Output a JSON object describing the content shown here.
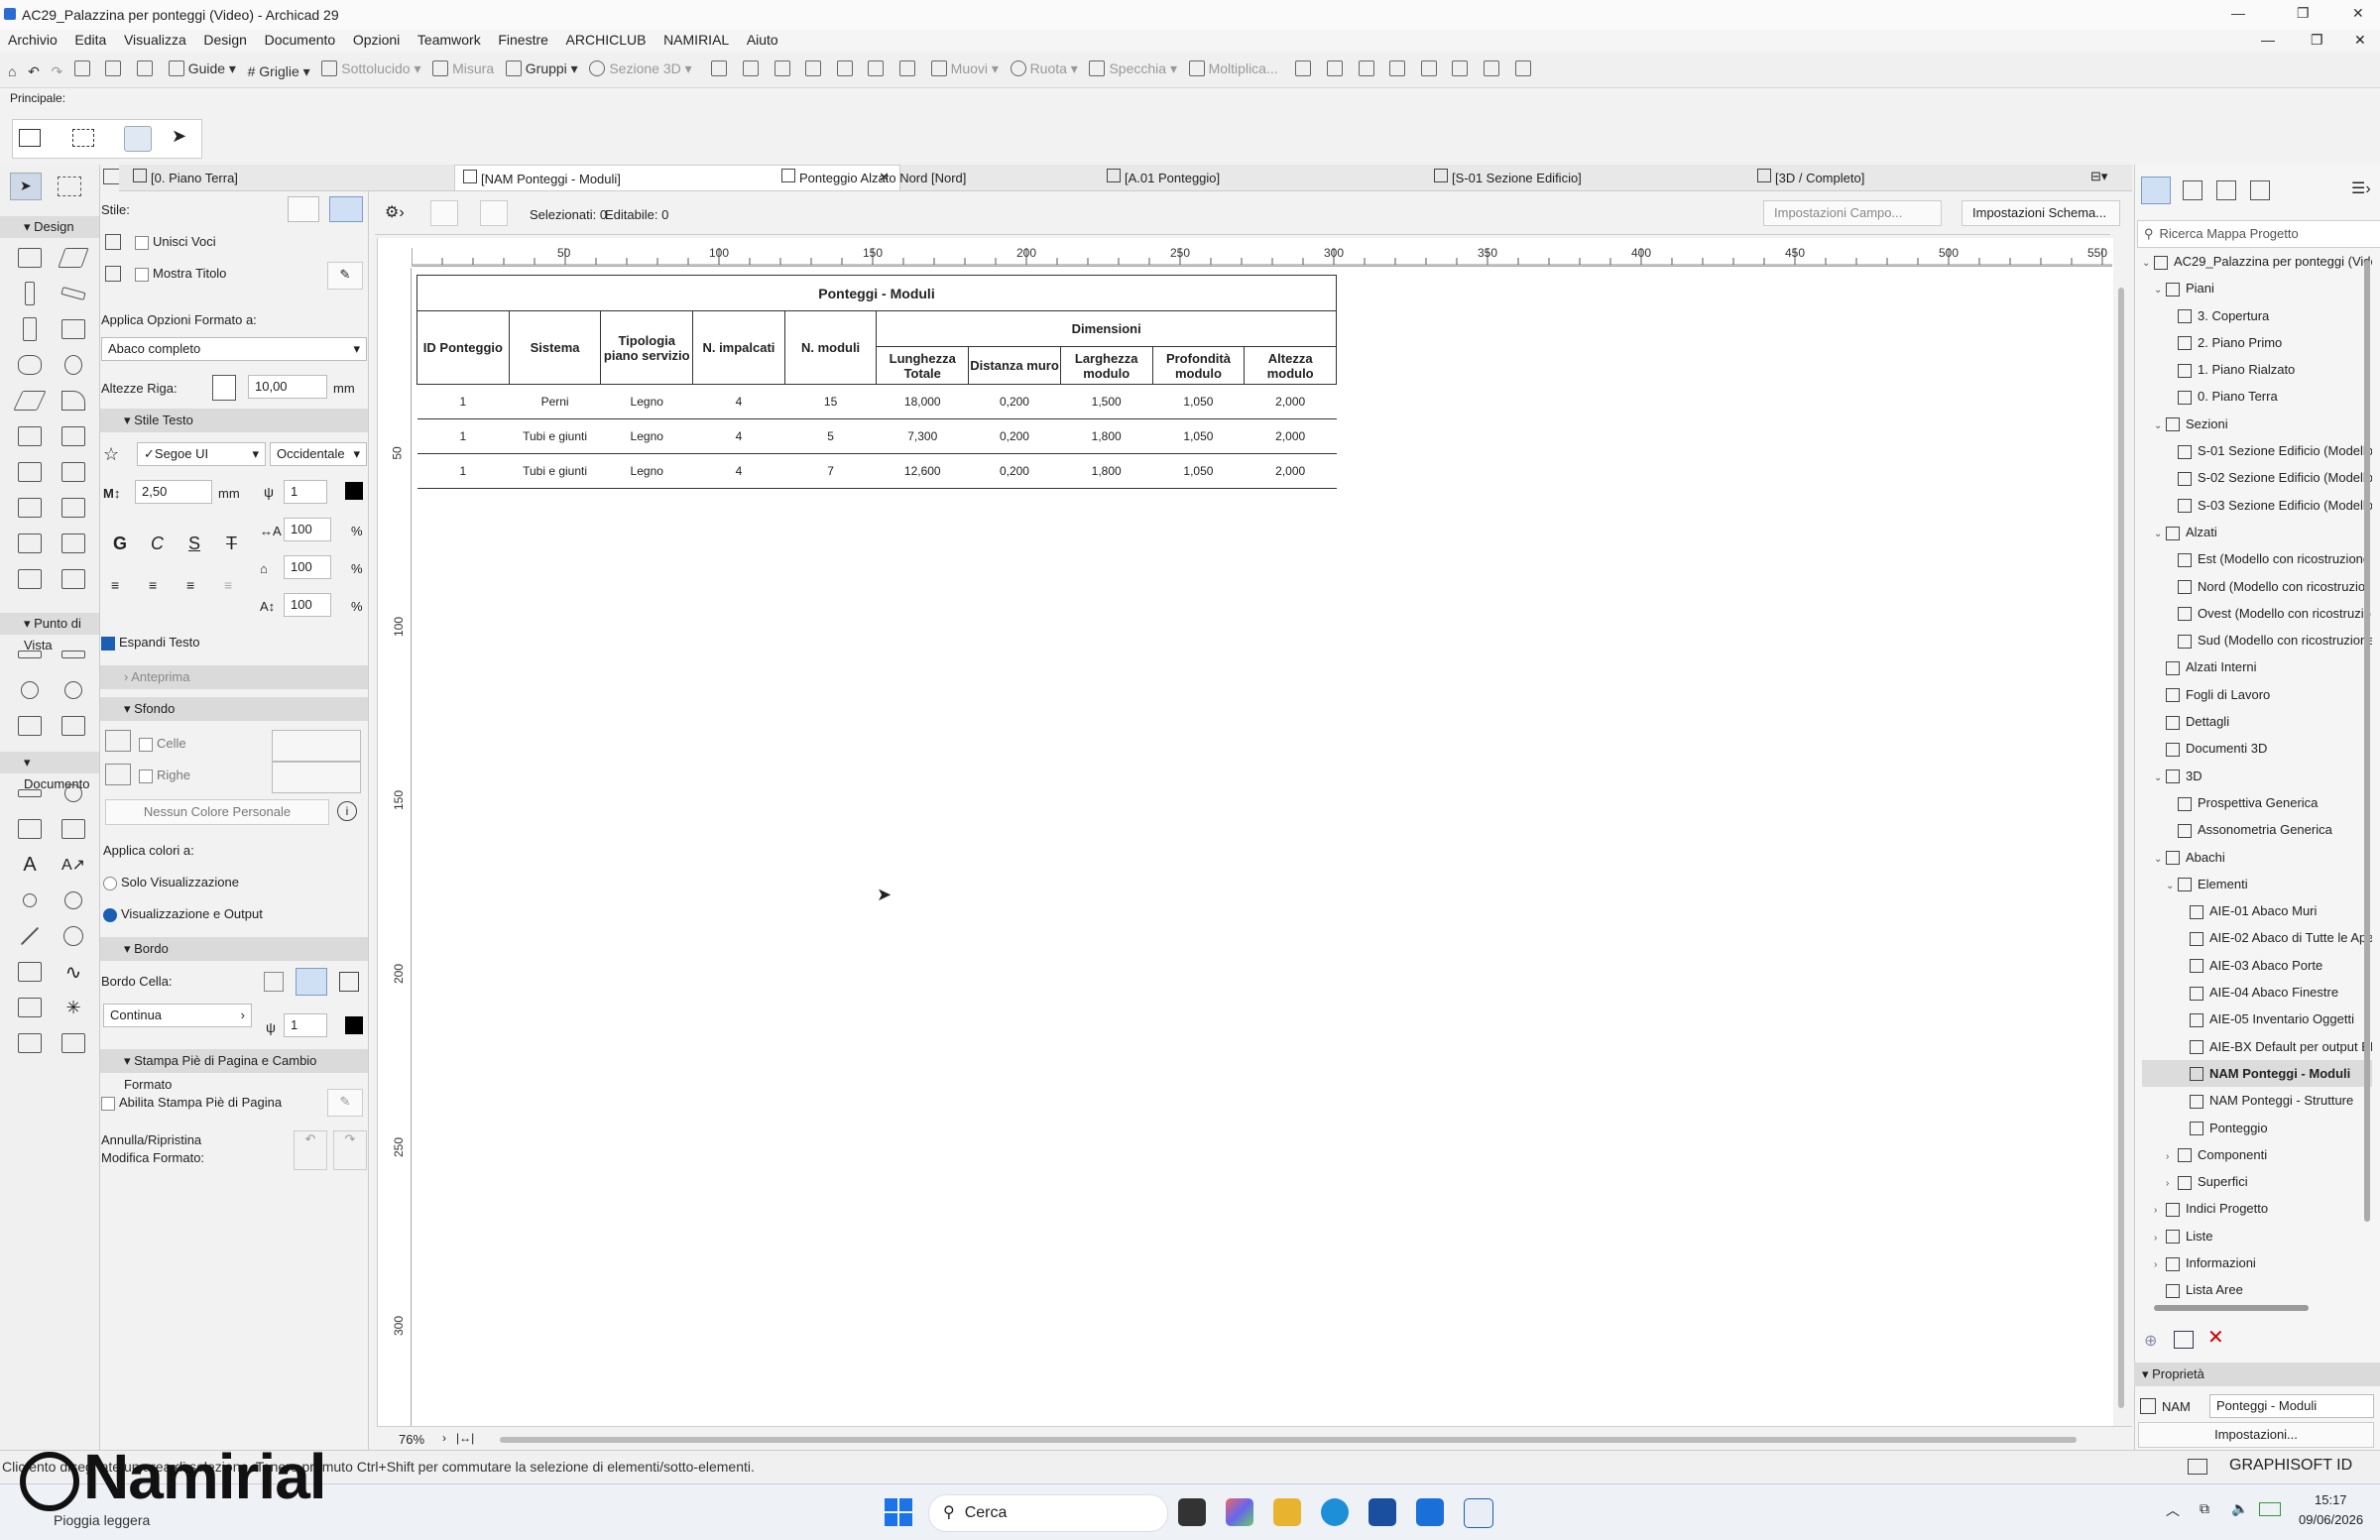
{
  "window": {
    "title": "AC29_Palazzina per ponteggi (Video) - Archicad 29"
  },
  "menu": [
    "Archivio",
    "Edita",
    "Visualizza",
    "Design",
    "Documento",
    "Opzioni",
    "Teamwork",
    "Finestre",
    "ARCHICLUB",
    "NAMIRIAL",
    "Aiuto"
  ],
  "toolbar": {
    "guide": "Guide",
    "griglie": "Griglie",
    "sottolucido": "Sottolucido",
    "misura": "Misura",
    "gruppi": "Gruppi",
    "sezione3d": "Sezione 3D",
    "muovi": "Muovi",
    "ruota": "Ruota",
    "specchia": "Specchia",
    "moltiplica": "Moltiplica..."
  },
  "principale": "Principale:",
  "toolbox": {
    "design": "Design",
    "punto_vista": "Punto di Vista",
    "documento": "Documento"
  },
  "format_panel": {
    "stile": "Stile:",
    "unisci_voci": "Unisci Voci",
    "mostra_titolo": "Mostra Titolo",
    "applica_opzioni": "Applica Opzioni Formato a:",
    "applica_value": "Abaco completo",
    "altezze_riga": "Altezze Riga:",
    "altezze_value": "10,00",
    "mm": "mm",
    "stile_testo": "Stile Testo",
    "font": "✓Segoe UI",
    "script": "Occidentale",
    "font_size": "2,50",
    "pen": "1",
    "pct": "100",
    "percent": "%",
    "espandi": "Espandi Testo",
    "anteprima": "Anteprima",
    "sfondo": "Sfondo",
    "celle": "Celle",
    "righe": "Righe",
    "nessun_colore": "Nessun Colore Personale",
    "applica_colori": "Applica colori a:",
    "solo_vis": "Solo Visualizzazione",
    "vis_output": "Visualizzazione e Output",
    "bordo": "Bordo",
    "bordo_cella": "Bordo Cella:",
    "linea": "Continua",
    "stampa": "Stampa Piè di Pagina e Cambio Formato",
    "abilita": "Abilita Stampa Piè di Pagina",
    "annulla": "Annulla/Ripristina",
    "modifica": "Modifica Formato:"
  },
  "tabs": [
    "[0. Piano Terra]",
    "[NAM Ponteggi - Moduli]",
    "Ponteggio Alzato Nord [Nord]",
    "[A.01 Ponteggio]",
    "[S-01 Sezione Edificio]",
    "[3D / Completo]"
  ],
  "schema_bar": {
    "selezionati": "Selezionati: 0",
    "editabile": "Editabile: 0",
    "imp_campo": "Impostazioni Campo...",
    "imp_schema": "Impostazioni Schema..."
  },
  "ruler_h": [
    "50",
    "100",
    "150",
    "200",
    "250",
    "300",
    "350",
    "400",
    "450",
    "500",
    "550"
  ],
  "ruler_v": [
    "50",
    "100",
    "150",
    "200",
    "250",
    "300"
  ],
  "schedule": {
    "title": "Ponteggi - Moduli",
    "headers": {
      "id": "ID Ponteggio",
      "sistema": "Sistema",
      "tipologia": "Tipologia piano servizio",
      "impalcati": "N. impalcati",
      "moduli": "N. moduli",
      "dimensioni": "Dimensioni"
    },
    "sub": [
      "Lunghezza Totale",
      "Distanza muro",
      "Larghezza modulo",
      "Profondità modulo",
      "Altezza modulo"
    ],
    "rows": [
      [
        "1",
        "Perni",
        "Legno",
        "4",
        "15",
        "18,000",
        "0,200",
        "1,500",
        "1,050",
        "2,000"
      ],
      [
        "1",
        "Tubi e giunti",
        "Legno",
        "4",
        "5",
        "7,300",
        "0,200",
        "1,800",
        "1,050",
        "2,000"
      ],
      [
        "1",
        "Tubi e giunti",
        "Legno",
        "4",
        "7",
        "12,600",
        "0,200",
        "1,800",
        "1,050",
        "2,000"
      ]
    ]
  },
  "zoom": "76%",
  "navigator": {
    "search": "Ricerca Mappa Progetto",
    "items": [
      {
        "label": "AC29_Palazzina per ponteggi (Vide",
        "lvl": 0,
        "arr": "v"
      },
      {
        "label": "Piani",
        "lvl": 1,
        "arr": "v"
      },
      {
        "label": "3. Copertura",
        "lvl": 2,
        "arr": ""
      },
      {
        "label": "2. Piano Primo",
        "lvl": 2,
        "arr": ""
      },
      {
        "label": "1. Piano Rialzato",
        "lvl": 2,
        "arr": ""
      },
      {
        "label": "0. Piano Terra",
        "lvl": 2,
        "arr": ""
      },
      {
        "label": "Sezioni",
        "lvl": 1,
        "arr": "v"
      },
      {
        "label": "S-01 Sezione Edificio (Modello",
        "lvl": 2,
        "arr": ""
      },
      {
        "label": "S-02 Sezione Edificio (Modello",
        "lvl": 2,
        "arr": ""
      },
      {
        "label": "S-03 Sezione Edificio (Modello",
        "lvl": 2,
        "arr": ""
      },
      {
        "label": "Alzati",
        "lvl": 1,
        "arr": "v"
      },
      {
        "label": "Est (Modello con ricostruzione",
        "lvl": 2,
        "arr": ""
      },
      {
        "label": "Nord (Modello con ricostruzio",
        "lvl": 2,
        "arr": ""
      },
      {
        "label": "Ovest (Modello con ricostruzio",
        "lvl": 2,
        "arr": ""
      },
      {
        "label": "Sud (Modello con ricostruzione",
        "lvl": 2,
        "arr": ""
      },
      {
        "label": "Alzati Interni",
        "lvl": 1,
        "arr": ""
      },
      {
        "label": "Fogli di Lavoro",
        "lvl": 1,
        "arr": ""
      },
      {
        "label": "Dettagli",
        "lvl": 1,
        "arr": ""
      },
      {
        "label": "Documenti 3D",
        "lvl": 1,
        "arr": ""
      },
      {
        "label": "3D",
        "lvl": 1,
        "arr": "v"
      },
      {
        "label": "Prospettiva Generica",
        "lvl": 2,
        "arr": ""
      },
      {
        "label": "Assonometria Generica",
        "lvl": 2,
        "arr": ""
      },
      {
        "label": "Abachi",
        "lvl": 1,
        "arr": "v"
      },
      {
        "label": "Elementi",
        "lvl": 2,
        "arr": "v"
      },
      {
        "label": "AIE-01 Abaco Muri",
        "lvl": 3,
        "arr": ""
      },
      {
        "label": "AIE-02 Abaco di Tutte le Ape",
        "lvl": 3,
        "arr": ""
      },
      {
        "label": "AIE-03 Abaco Porte",
        "lvl": 3,
        "arr": ""
      },
      {
        "label": "AIE-04 Abaco Finestre",
        "lvl": 3,
        "arr": ""
      },
      {
        "label": "AIE-05 Inventario Oggetti",
        "lvl": 3,
        "arr": ""
      },
      {
        "label": "AIE-BX Default per output BI",
        "lvl": 3,
        "arr": ""
      },
      {
        "label": "NAM Ponteggi - Moduli",
        "lvl": 3,
        "arr": "",
        "sel": true
      },
      {
        "label": "NAM Ponteggi - Strutture",
        "lvl": 3,
        "arr": ""
      },
      {
        "label": "Ponteggio",
        "lvl": 3,
        "arr": ""
      },
      {
        "label": "Componenti",
        "lvl": 2,
        "arr": ">"
      },
      {
        "label": "Superfici",
        "lvl": 2,
        "arr": ">"
      },
      {
        "label": "Indici Progetto",
        "lvl": 1,
        "arr": ">"
      },
      {
        "label": "Liste",
        "lvl": 1,
        "arr": ">"
      },
      {
        "label": "Informazioni",
        "lvl": 1,
        "arr": ">"
      },
      {
        "label": "Lista Aree",
        "lvl": 1,
        "arr": ""
      }
    ]
  },
  "proprieta": {
    "title": "Proprietà",
    "key": "NAM",
    "value": "Ponteggi - Moduli",
    "btn": "Impostazioni..."
  },
  "status": {
    "text": "Clic        ento        disegnate un area di selezione. Tenere premuto Ctrl+Shift per commutare la selezione di elementi/sotto-elementi.",
    "graphisoft": "GRAPHISOFT ID"
  },
  "watermark": "Namirial",
  "taskbar": {
    "weather": "Pioggia leggera",
    "search": "Cerca",
    "time": "15:17",
    "date": "09/06/2026"
  }
}
